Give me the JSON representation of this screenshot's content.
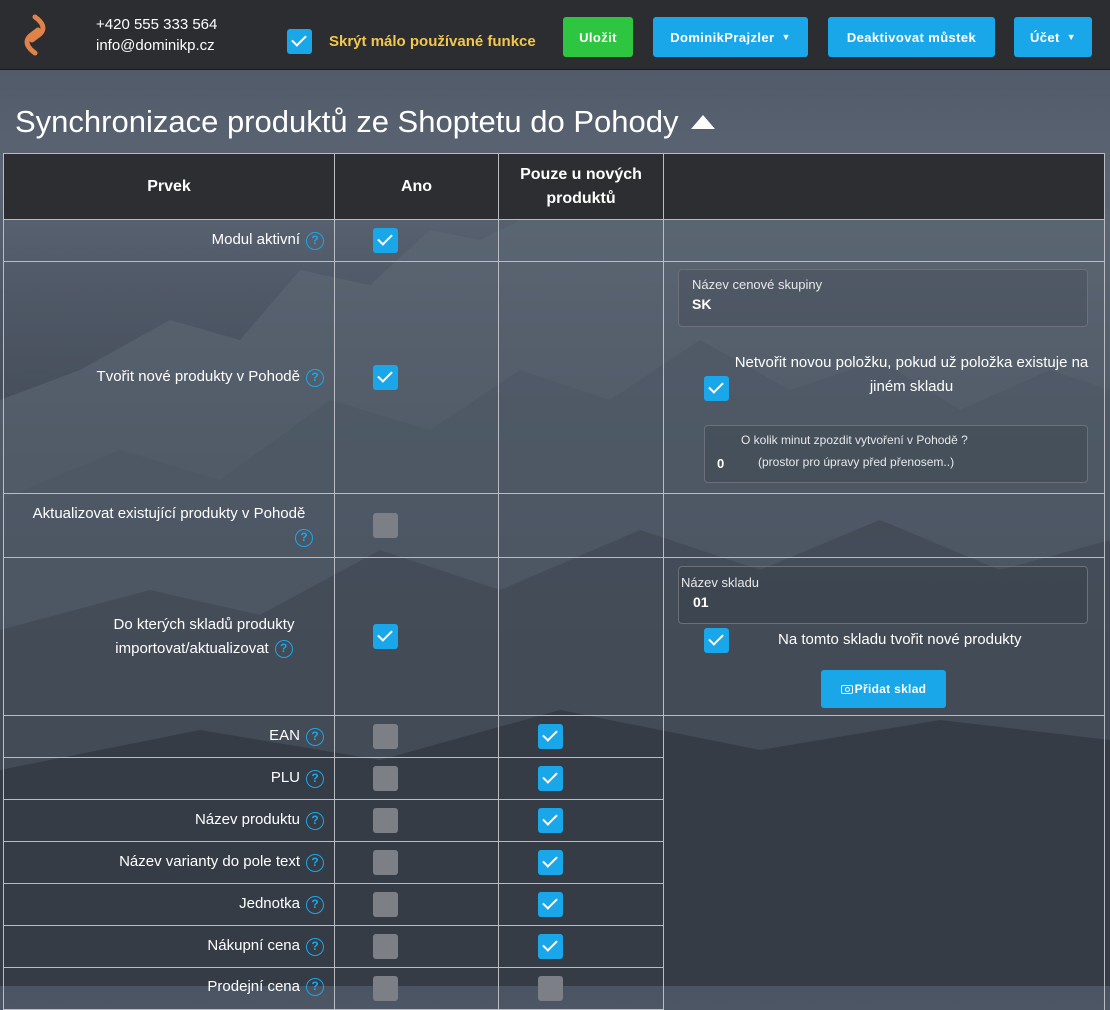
{
  "header": {
    "phone": "+420 555 333 564",
    "email": "info@dominikp.cz",
    "hide_rare_label": "Skrýt málo používané funkce",
    "hide_rare_checked": true,
    "save_label": "Uložit",
    "user_label": "DominikPrajzler",
    "deactivate_label": "Deaktivovat můstek",
    "account_label": "Účet"
  },
  "page": {
    "title": "Synchronizace produktů ze Shoptetu do Pohody"
  },
  "table": {
    "headers": {
      "element": "Prvek",
      "yes": "Ano",
      "new_only": "Pouze u nových produktů"
    },
    "rows": [
      {
        "label": "Modul aktivní",
        "yes": true
      },
      {
        "label": "Tvořit nové produkty v Pohodě",
        "yes": true
      },
      {
        "label": "Aktualizovat existující produkty v Pohodě",
        "yes": false
      },
      {
        "label": "Do kterých skladů produkty importovat/aktualizovat",
        "yes": true
      },
      {
        "label": "EAN",
        "yes": false,
        "new_only": true
      },
      {
        "label": "PLU",
        "yes": false,
        "new_only": true
      },
      {
        "label": "Název produktu",
        "yes": false,
        "new_only": true
      },
      {
        "label": "Název varianty do pole text",
        "yes": false,
        "new_only": true
      },
      {
        "label": "Jednotka",
        "yes": false,
        "new_only": true
      },
      {
        "label": "Nákupní cena",
        "yes": false,
        "new_only": true
      },
      {
        "label": "Prodejní cena",
        "yes": false,
        "new_only": false
      }
    ]
  },
  "create_products_options": {
    "price_group_label": "Název cenové skupiny",
    "price_group_value": "SK",
    "dont_create_label": "Netvořit novou položku, pokud už položka existuje na jiném skladu",
    "dont_create_checked": true,
    "delay_label": "O kolik minut zpozdit vytvoření v Pohodě ?",
    "delay_sublabel": "(prostor pro úpravy před přenosem..)",
    "delay_value": "0"
  },
  "warehouse_options": {
    "warehouse_name_label": "Název skladu",
    "warehouse_name_value": "01",
    "create_here_label": "Na tomto skladu tvořit nové produkty",
    "create_here_checked": true,
    "add_warehouse_label": "Přidat sklad"
  },
  "icons": {
    "help": "?"
  },
  "colors": {
    "accent_blue": "#1aa7ea",
    "save_green": "#2ec640",
    "warning_yellow": "#f3c64e",
    "header_bg": "#2b2d30"
  }
}
